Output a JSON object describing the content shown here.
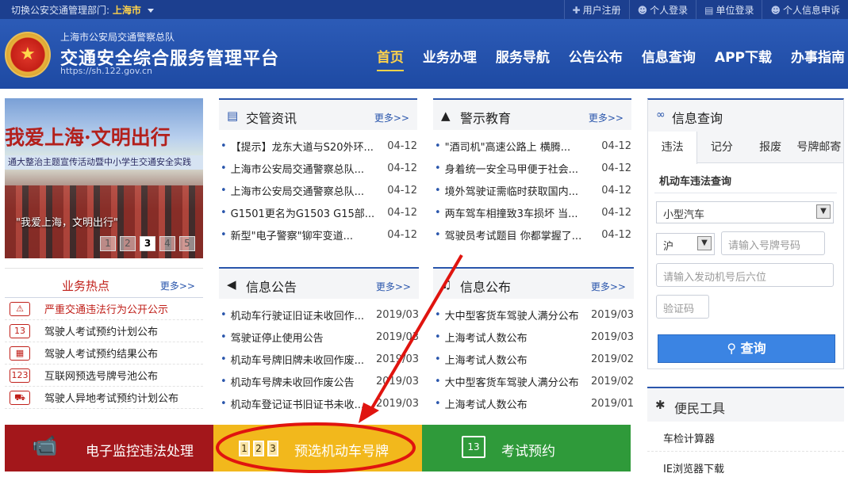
{
  "topbar": {
    "switch_label": "切换公安交通管理部门:",
    "city": "上海市",
    "links": [
      "用户注册",
      "个人登录",
      "单位登录",
      "个人信息申诉"
    ]
  },
  "header": {
    "subtitle": "上海市公安局交通警察总队",
    "title": "交通安全综合服务管理平台",
    "url": "https://sh.122.gov.cn",
    "nav": [
      "首页",
      "业务办理",
      "服务导航",
      "公告公布",
      "信息查询",
      "APP下载",
      "办事指南"
    ],
    "active_nav": "首页"
  },
  "banner": {
    "slogan": "我爱上海·文明出行",
    "strip_text": "通大整治主题宣传活动暨中小学生交通安全实践",
    "caption": "\"我爱上海，文明出行\"",
    "pages": [
      "1",
      "2",
      "3",
      "4",
      "5"
    ],
    "active_page": "3"
  },
  "news": {
    "title": "交管资讯",
    "more": "更多>>",
    "items": [
      {
        "text": "【提示】龙东大道与S20外环...",
        "date": "04-12"
      },
      {
        "text": "上海市公安局交通警察总队...",
        "date": "04-12"
      },
      {
        "text": "上海市公安局交通警察总队...",
        "date": "04-12"
      },
      {
        "text": "G1501更名为G1503 G15部...",
        "date": "04-12"
      },
      {
        "text": "新型\"电子警察\"铆牢变道...",
        "date": "04-12"
      }
    ]
  },
  "warning": {
    "title": "警示教育",
    "more": "更多>>",
    "items": [
      {
        "text": "\"酒司机\"高速公路上 横腾...",
        "date": "04-12"
      },
      {
        "text": "身着统一安全马甲便于社会...",
        "date": "04-12"
      },
      {
        "text": "境外驾驶证需临时获取国内...",
        "date": "04-12"
      },
      {
        "text": "两车驾车相撞致3车损坏 当...",
        "date": "04-12"
      },
      {
        "text": "驾驶员考试题目 你都掌握了...",
        "date": "04-12"
      }
    ]
  },
  "hot": {
    "title": "业务热点",
    "more": "更多>>",
    "items": [
      {
        "text": "严重交通违法行为公开公示",
        "icon": "warning-triangle-icon"
      },
      {
        "text": "驾驶人考试预约计划公布",
        "icon": "calendar-icon"
      },
      {
        "text": "驾驶人考试预约结果公布",
        "icon": "calendar-grid-icon"
      },
      {
        "text": "互联网预选号牌号池公布",
        "icon": "plate-icon"
      },
      {
        "text": "驾驶人异地考试预约计划公布",
        "icon": "car-icon"
      }
    ]
  },
  "notice": {
    "title": "信息公告",
    "more": "更多>>",
    "items": [
      {
        "text": "机动车行驶证旧证未收回作...",
        "date": "2019/03"
      },
      {
        "text": "驾驶证停止使用公告",
        "date": "2019/03"
      },
      {
        "text": "机动车号牌旧牌未收回作废...",
        "date": "2019/03"
      },
      {
        "text": "机动车号牌未收回作废公告",
        "date": "2019/03"
      },
      {
        "text": "机动车登记证书旧证书未收...",
        "date": "2019/03"
      }
    ]
  },
  "publish": {
    "title": "信息公布",
    "more": "更多>>",
    "items": [
      {
        "text": "大中型客货车驾驶人满分公布",
        "date": "2019/03"
      },
      {
        "text": "上海考试人数公布",
        "date": "2019/03"
      },
      {
        "text": "上海考试人数公布",
        "date": "2019/02"
      },
      {
        "text": "大中型客货车驾驶人满分公布",
        "date": "2019/02"
      },
      {
        "text": "上海考试人数公布",
        "date": "2019/01"
      }
    ]
  },
  "query": {
    "title": "信息查询",
    "tabs": [
      "违法",
      "记分",
      "报废",
      "号牌邮寄"
    ],
    "active_tab": "违法",
    "subtitle": "机动车违法查询",
    "vehicle_type": "小型汽车",
    "province": "沪",
    "plate_placeholder": "请输入号牌号码",
    "engine_placeholder": "请输入发动机号后六位",
    "captcha_placeholder": "验证码",
    "button": "查询"
  },
  "tools": {
    "title": "便民工具",
    "items": [
      "车检计算器",
      "IE浏览器下载"
    ]
  },
  "tiles": [
    {
      "label": "电子监控违法处理",
      "color": "#a3171b",
      "icon": "camera-icon"
    },
    {
      "label": "预选机动车号牌",
      "color": "#f2b81c",
      "icon": "plate-number-icon",
      "digits": [
        "1",
        "2",
        "3"
      ]
    },
    {
      "label": "考试预约",
      "color": "#2f9a3a",
      "icon": "calendar-13-icon",
      "calendar_day": "13"
    }
  ]
}
